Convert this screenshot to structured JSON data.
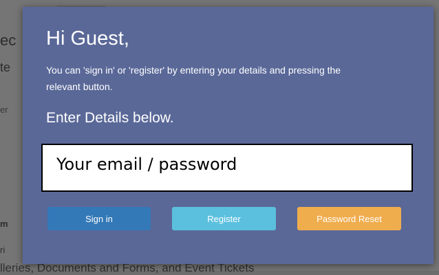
{
  "background": {
    "fragments": [
      "ec",
      "te",
      "er",
      "m",
      "ri"
    ],
    "bottom_text": "lleries, Documents and Forms, and Event Tickets"
  },
  "modal": {
    "greeting": "Hi Guest,",
    "instructions": "You can 'sign in' or 'register' by entering your details and pressing the relevant button.",
    "section_heading": "Enter Details below.",
    "credential_box_text": "Your email / password",
    "buttons": {
      "sign_in": "Sign in",
      "register": "Register",
      "password_reset": "Password Reset"
    },
    "colors": {
      "modal_bg": "#5a6898",
      "sign_in": "#3479b7",
      "register": "#5bc0de",
      "password_reset": "#f0ad4e"
    }
  }
}
